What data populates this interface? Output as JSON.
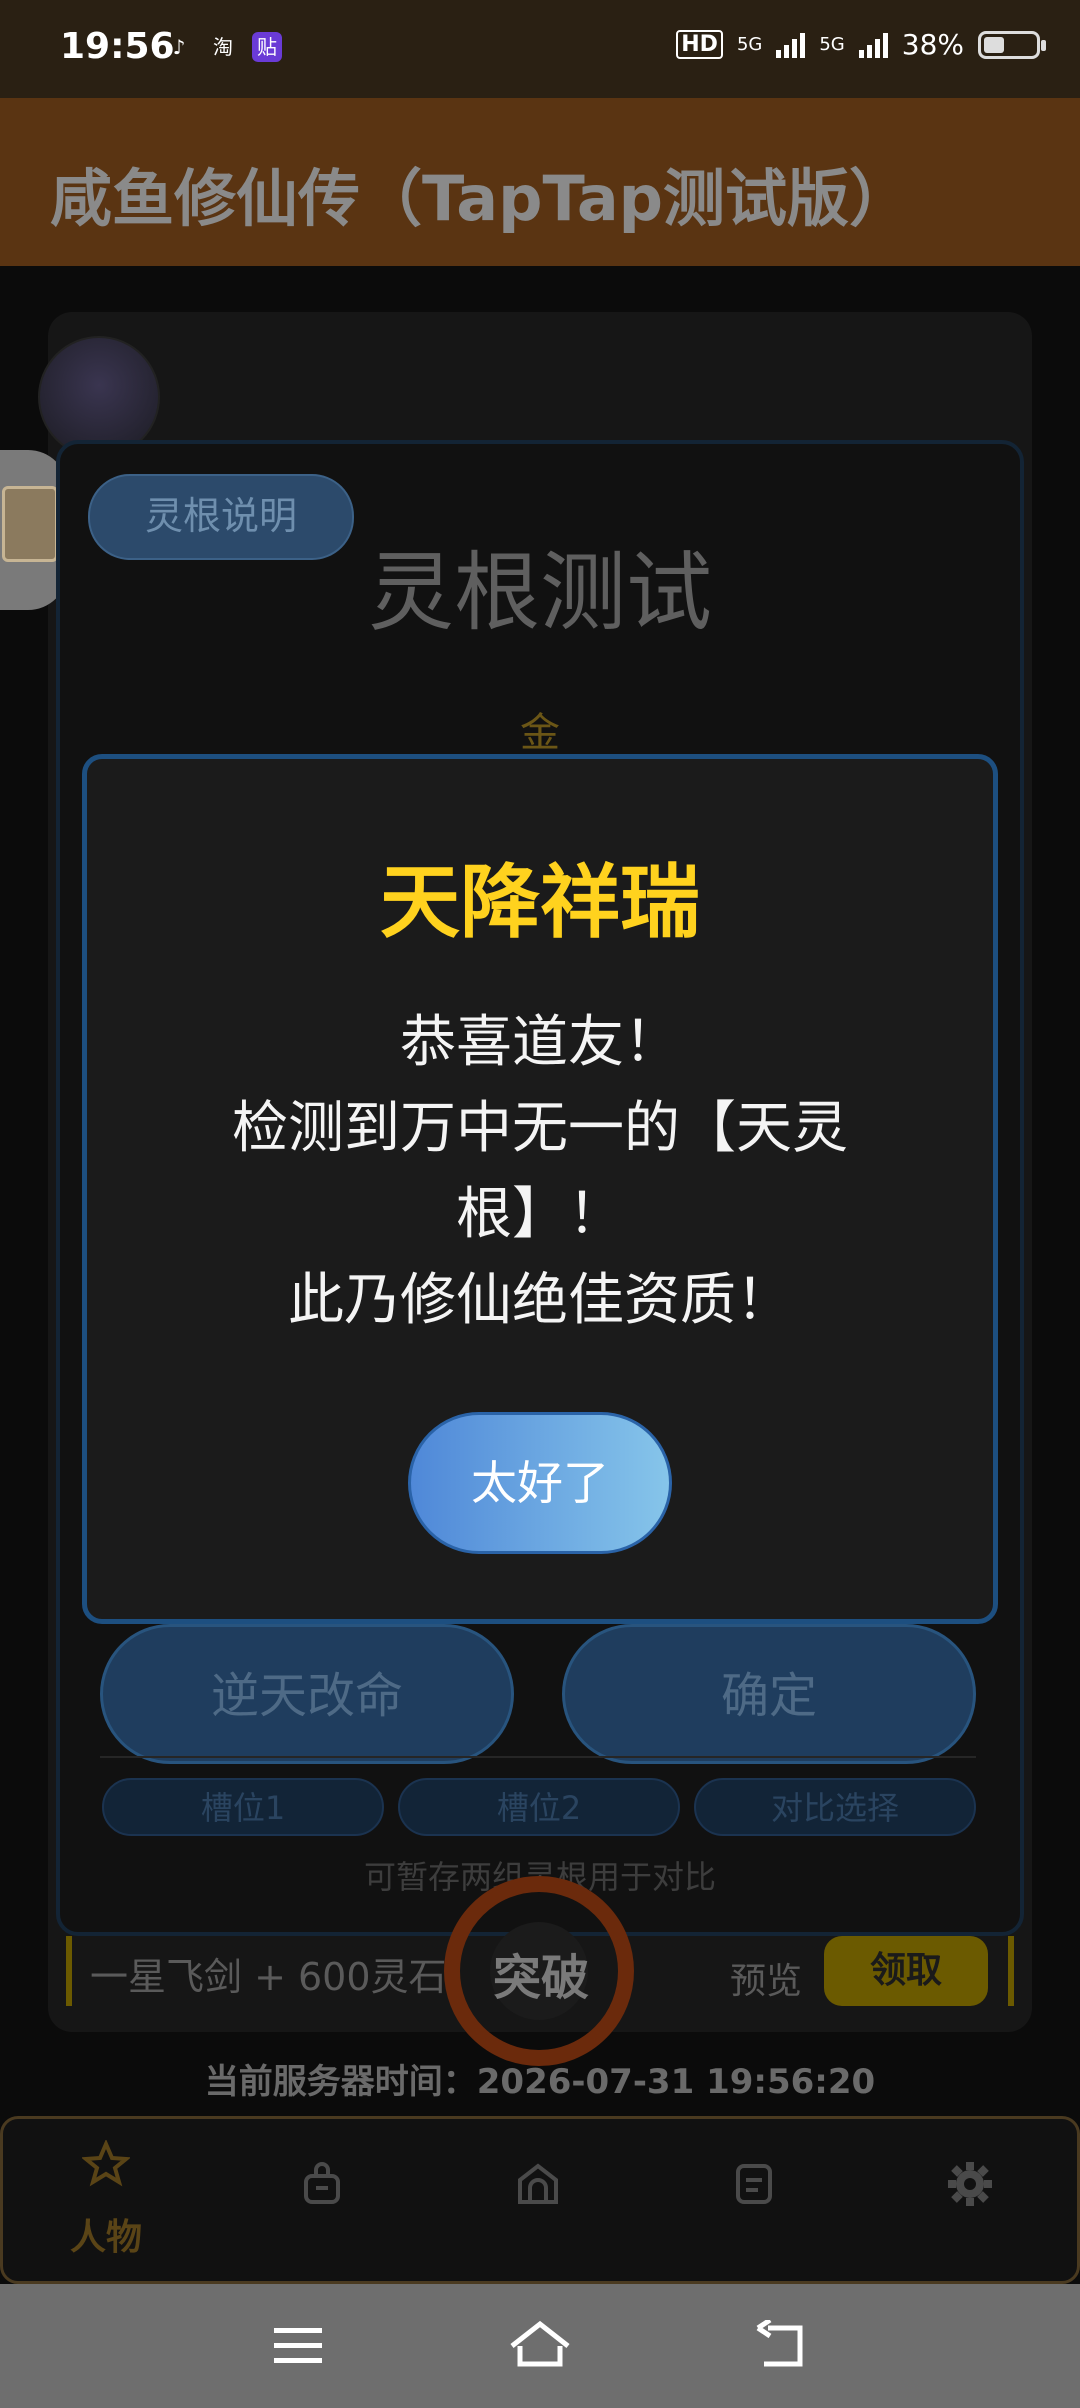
{
  "status_bar": {
    "time": "19:56",
    "app_icons": [
      "tiktok-icon",
      "taobao-icon",
      "tieba-icon"
    ],
    "taobao_label": "淘",
    "tieba_label": "贴",
    "hd_label": "HD",
    "net1": "5G",
    "net2": "5G",
    "battery": "38%"
  },
  "app_header": {
    "title": "咸鱼修仙传（TapTap测试版）"
  },
  "lingen_dialog": {
    "explain_button": "灵根说明",
    "title": "灵根测试",
    "element": "金",
    "left_button": "逆天改命",
    "right_button": "确定",
    "slots": [
      "槽位1",
      "槽位2",
      "对比选择"
    ],
    "hint": "可暂存两组灵根用于对比"
  },
  "reward": {
    "text": "一星飞剑 + 600灵石",
    "preview": "预览",
    "claim": "领取",
    "breakthrough": "突破"
  },
  "server_time": "当前服务器时间：2026-07-31 19:56:20",
  "bottom_nav": {
    "items": [
      {
        "label": "人物",
        "icon": "star-icon"
      },
      {
        "label": "",
        "icon": "bag-icon"
      },
      {
        "label": "",
        "icon": "sect-icon"
      },
      {
        "label": "",
        "icon": "document-icon"
      },
      {
        "label": "",
        "icon": "gear-icon"
      }
    ]
  },
  "modal": {
    "title": "天降祥瑞",
    "lines": [
      "恭喜道友！",
      "检测到万中无一的【天灵",
      "根】！",
      "此乃修仙绝佳资质！"
    ],
    "ok_button": "太好了"
  },
  "colors": {
    "accent_gold": "#ffd21e",
    "modal_border": "#1d4f80",
    "button_gradient_start": "#4f88d8",
    "button_gradient_end": "#86c5ea"
  }
}
